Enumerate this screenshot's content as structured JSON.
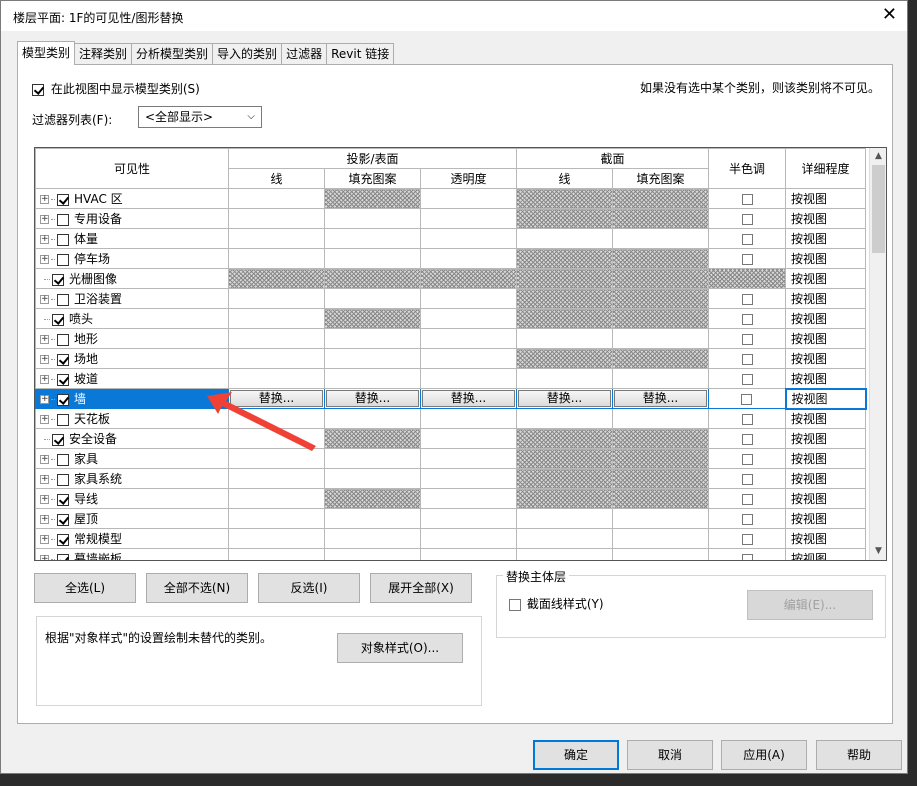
{
  "window": {
    "title": "楼层平面: 1F的可见性/图形替换",
    "close_glyph": "✕"
  },
  "tabs": [
    "模型类别",
    "注释类别",
    "分析模型类别",
    "导入的类别",
    "过滤器",
    "Revit 链接"
  ],
  "show_model_categories": {
    "label": "在此视图中显示模型类别(S)",
    "checked": true
  },
  "hint": "如果没有选中某个类别，则该类别将不可见。",
  "filter": {
    "label": "过滤器列表(F):",
    "value": "<全部显示>"
  },
  "grid": {
    "headers": {
      "visibility": "可见性",
      "projection": "投影/表面",
      "section": "截面",
      "halftone": "半色调",
      "detail": "详细程度",
      "line": "线",
      "fill": "填充图案",
      "transparency": "透明度",
      "sec_line": "线",
      "sec_fill": "填充图案"
    },
    "override_label": "替换...",
    "rows": [
      {
        "name": "HVAC 区",
        "checked": true,
        "expand": true,
        "detail": "按视图",
        "proj_line": false,
        "proj_fill": true,
        "transp": false,
        "sec": true,
        "halftone_box": true
      },
      {
        "name": "专用设备",
        "checked": false,
        "expand": true,
        "detail": "按视图",
        "proj_line": false,
        "proj_fill": false,
        "transp": false,
        "sec": true,
        "halftone_box": true
      },
      {
        "name": "体量",
        "checked": false,
        "expand": true,
        "detail": "按视图",
        "proj_line": false,
        "proj_fill": false,
        "transp": false,
        "sec": false,
        "halftone_box": true
      },
      {
        "name": "停车场",
        "checked": false,
        "expand": true,
        "detail": "按视图",
        "proj_line": false,
        "proj_fill": false,
        "transp": false,
        "sec": true,
        "halftone_box": true
      },
      {
        "name": "光栅图像",
        "checked": true,
        "expand": false,
        "detail": "按视图",
        "proj_line": true,
        "proj_fill": true,
        "transp": true,
        "sec": true,
        "halftone_box": false
      },
      {
        "name": "卫浴装置",
        "checked": false,
        "expand": true,
        "detail": "按视图",
        "proj_line": false,
        "proj_fill": false,
        "transp": false,
        "sec": true,
        "halftone_box": true
      },
      {
        "name": "喷头",
        "checked": true,
        "expand": false,
        "detail": "按视图",
        "proj_line": false,
        "proj_fill": true,
        "transp": false,
        "sec": true,
        "halftone_box": true
      },
      {
        "name": "地形",
        "checked": false,
        "expand": true,
        "detail": "按视图",
        "proj_line": false,
        "proj_fill": false,
        "transp": false,
        "sec": false,
        "halftone_box": true
      },
      {
        "name": "场地",
        "checked": true,
        "expand": true,
        "detail": "按视图",
        "proj_line": false,
        "proj_fill": false,
        "transp": false,
        "sec": true,
        "halftone_box": true
      },
      {
        "name": "坡道",
        "checked": true,
        "expand": true,
        "detail": "按视图",
        "proj_line": false,
        "proj_fill": false,
        "transp": false,
        "sec": false,
        "halftone_box": true
      },
      {
        "name": "墙",
        "checked": true,
        "expand": true,
        "detail": "按视图",
        "selected": true,
        "halftone_box": true
      },
      {
        "name": "天花板",
        "checked": false,
        "expand": true,
        "detail": "按视图",
        "proj_line": false,
        "proj_fill": false,
        "transp": false,
        "sec": false,
        "halftone_box": true
      },
      {
        "name": "安全设备",
        "checked": true,
        "expand": false,
        "detail": "按视图",
        "proj_line": false,
        "proj_fill": true,
        "transp": false,
        "sec": true,
        "halftone_box": true
      },
      {
        "name": "家具",
        "checked": false,
        "expand": true,
        "detail": "按视图",
        "proj_line": false,
        "proj_fill": false,
        "transp": false,
        "sec": true,
        "halftone_box": true
      },
      {
        "name": "家具系统",
        "checked": false,
        "expand": true,
        "detail": "按视图",
        "proj_line": false,
        "proj_fill": false,
        "transp": false,
        "sec": true,
        "halftone_box": true
      },
      {
        "name": "导线",
        "checked": true,
        "expand": true,
        "detail": "按视图",
        "proj_line": false,
        "proj_fill": true,
        "transp": false,
        "sec": true,
        "halftone_box": true
      },
      {
        "name": "屋顶",
        "checked": true,
        "expand": true,
        "detail": "按视图",
        "proj_line": false,
        "proj_fill": false,
        "transp": false,
        "sec": false,
        "halftone_box": true
      },
      {
        "name": "常规模型",
        "checked": true,
        "expand": true,
        "detail": "按视图",
        "proj_line": false,
        "proj_fill": false,
        "transp": false,
        "sec": false,
        "halftone_box": true
      },
      {
        "name": "幕墙嵌板",
        "checked": true,
        "expand": true,
        "detail": "按视图",
        "proj_line": false,
        "proj_fill": false,
        "transp": false,
        "sec": false,
        "halftone_box": true
      }
    ]
  },
  "buttons": {
    "select_all": "全选(L)",
    "select_none": "全部不选(N)",
    "invert": "反选(I)",
    "expand_all": "展开全部(X)",
    "object_styles": "对象样式(O)...",
    "edit": "编辑(E)...",
    "ok": "确定",
    "cancel": "取消",
    "apply": "应用(A)",
    "help": "帮助"
  },
  "host_layers": {
    "legend": "替换主体层",
    "section_line_label": "截面线样式(Y)",
    "checked": false
  },
  "note": "根据\"对象样式\"的设置绘制未替代的类别。",
  "colors": {
    "selection": "#0a78d7",
    "annotation_arrow": "#ef4136",
    "primary_border": "#0078d7"
  }
}
